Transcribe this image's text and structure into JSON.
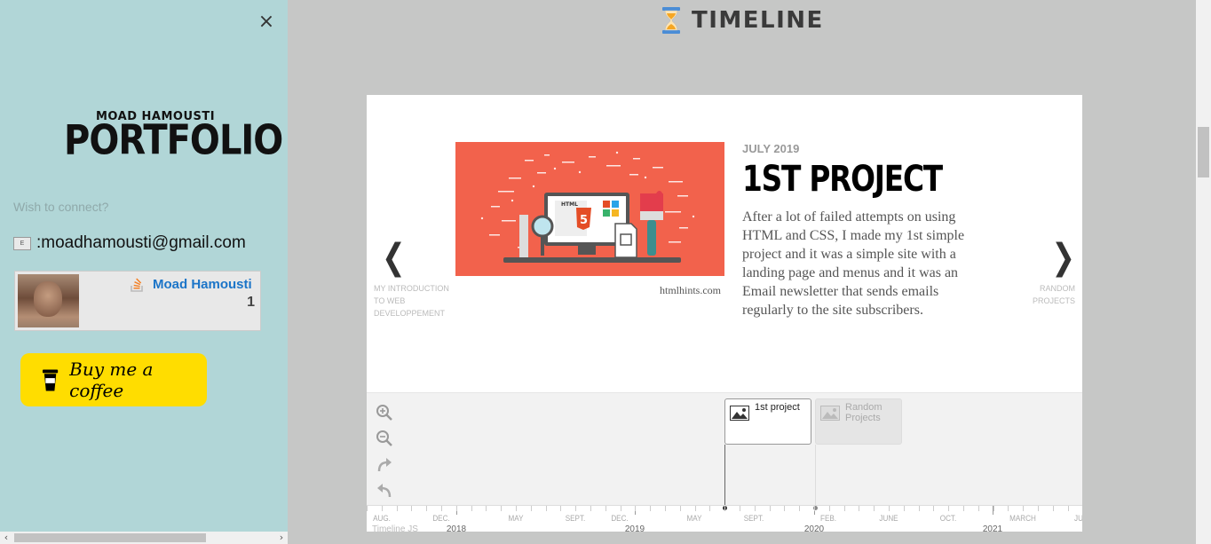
{
  "sidebar": {
    "close_icon": "×",
    "logo_line1": "MOAD HAMOUSTI",
    "logo_line2": "PORTFOLIO",
    "connect_prompt": "Wish to connect?",
    "email_prefix": ": ",
    "email": "moadhamousti@gmail.com",
    "stackoverflow": {
      "name": "Moad Hamousti",
      "reputation": "1"
    },
    "coffee_label": "Buy me a coffee"
  },
  "header": {
    "title": "TIMELINE"
  },
  "timeline": {
    "prev": {
      "arrow": "❮",
      "title": "MY INTRODUCTION TO WEB DEVELOPPEMENT"
    },
    "next": {
      "arrow": "❯",
      "title": "RANDOM PROJECTS"
    },
    "slide": {
      "date": "JULY 2019",
      "title": "1ST PROJECT",
      "text": "After a lot of failed attempts on using HTML and CSS, I made my 1st simple project and it was a simple site with a landing page and menus and it was an Email newsletter that sends emails regularly to the site subscribers.",
      "credit": "htmlhints.com",
      "media_label": "HTML"
    },
    "markers": [
      {
        "label": "1st project",
        "active": true
      },
      {
        "label": "Random Projects",
        "active": false
      }
    ],
    "months": [
      "AUG.",
      "DEC.",
      "MAY",
      "SEPT.",
      "DEC.",
      "MAY",
      "SEPT.",
      "FEB.",
      "JUNE",
      "OCT.",
      "MARCH",
      "JU"
    ],
    "years": [
      "2018",
      "2019",
      "2020",
      "2021"
    ],
    "branding": "Timeline JS"
  },
  "colors": {
    "sidebar_bg": "#b1d6d7",
    "page_bg": "#c6c7c6",
    "media_bg": "#f2624c",
    "coffee_bg": "#ffdd00",
    "so_blue": "#1c75c8"
  },
  "icons": [
    "close-icon",
    "email-icon",
    "stackoverflow-icon",
    "coffee-cup-icon",
    "hourglass-icon",
    "zoom-in-icon",
    "zoom-out-icon",
    "redo-icon",
    "undo-icon",
    "image-icon"
  ]
}
